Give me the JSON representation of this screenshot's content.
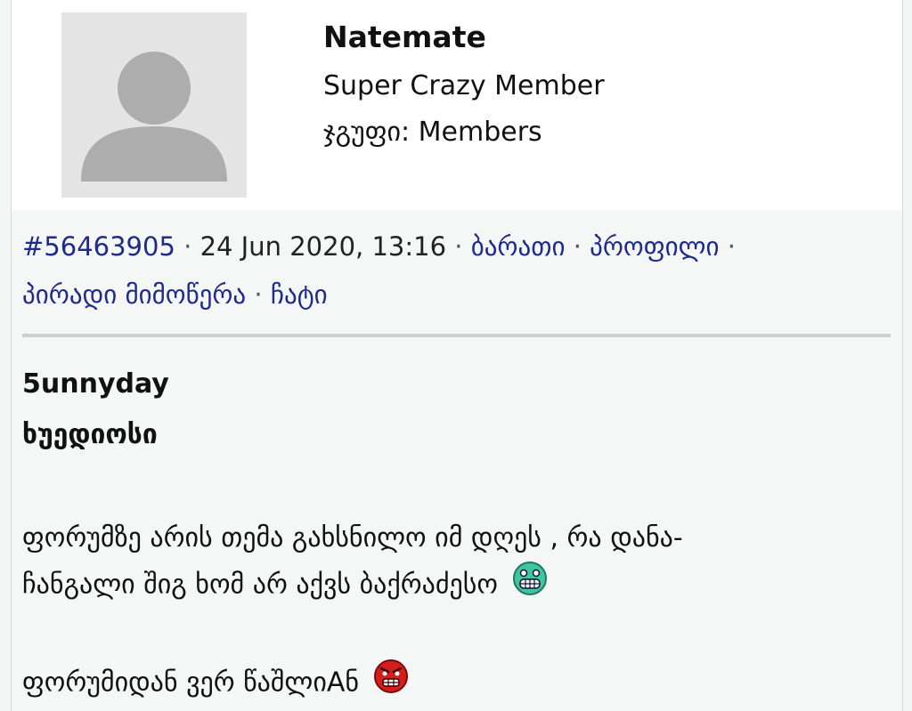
{
  "author": {
    "name": "Natemate",
    "title": "Super Crazy Member",
    "group": "ჯგუფი: Members"
  },
  "meta": {
    "post_id": "#56463905",
    "datetime": "24 Jun 2020, 13:16",
    "links": [
      "ბარათი",
      "პროფილი",
      "პირადი მიმოწერა",
      "ჩატი"
    ],
    "separator": "·"
  },
  "quote": {
    "author": "5unnyday",
    "title": "ხუედიოსი"
  },
  "body": {
    "line1": "ფორუმზე არის თემა გახსნილო იმ დღეს , რა დანა-",
    "line2": "ჩანგალი შიგ ხომ არ აქვს ბაქრაძესო",
    "line2_emoji": "grinning-face-icon",
    "para2": "ფორუმიდან ვერ წაშლიАნ",
    "para2_emoji": "angry-face-icon"
  },
  "colors": {
    "link": "#1e2a8c",
    "avatar_bg": "#e4e4e4",
    "avatar_fg": "#adadad",
    "divider": "#cfcfcf"
  }
}
